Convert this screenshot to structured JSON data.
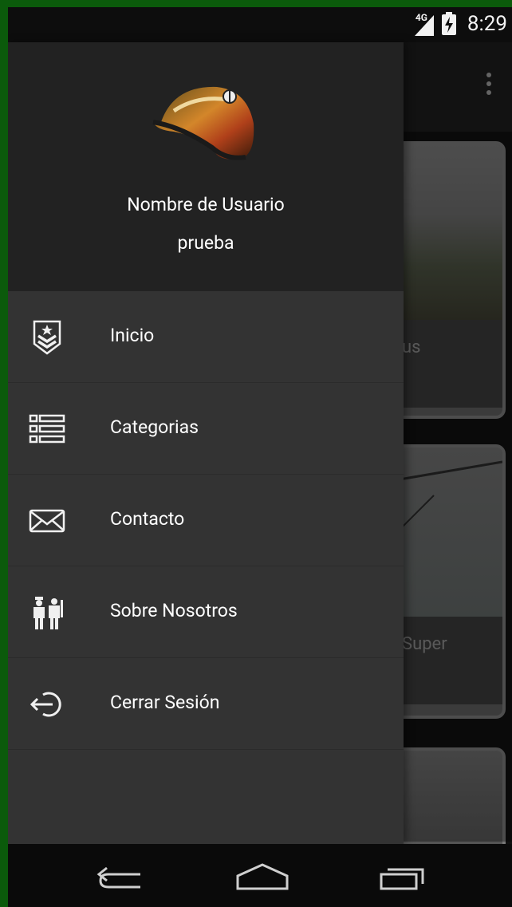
{
  "status_bar": {
    "network": "4G",
    "time": "8:29"
  },
  "background": {
    "cards": [
      {
        "caption_fragment": "us"
      },
      {
        "caption_fragment": "Super"
      },
      {
        "caption_fragment": ""
      }
    ]
  },
  "drawer": {
    "header": {
      "user_label": "Nombre de Usuario",
      "user_name": "prueba"
    },
    "items": [
      {
        "label": "Inicio",
        "icon": "rank-badge-icon"
      },
      {
        "label": "Categorias",
        "icon": "list-icon"
      },
      {
        "label": "Contacto",
        "icon": "envelope-icon"
      },
      {
        "label": "Sobre Nosotros",
        "icon": "soldiers-icon"
      },
      {
        "label": "Cerrar Sesión",
        "icon": "logout-icon"
      }
    ]
  },
  "nav_bar": {
    "buttons": [
      "back",
      "home",
      "recents"
    ]
  }
}
